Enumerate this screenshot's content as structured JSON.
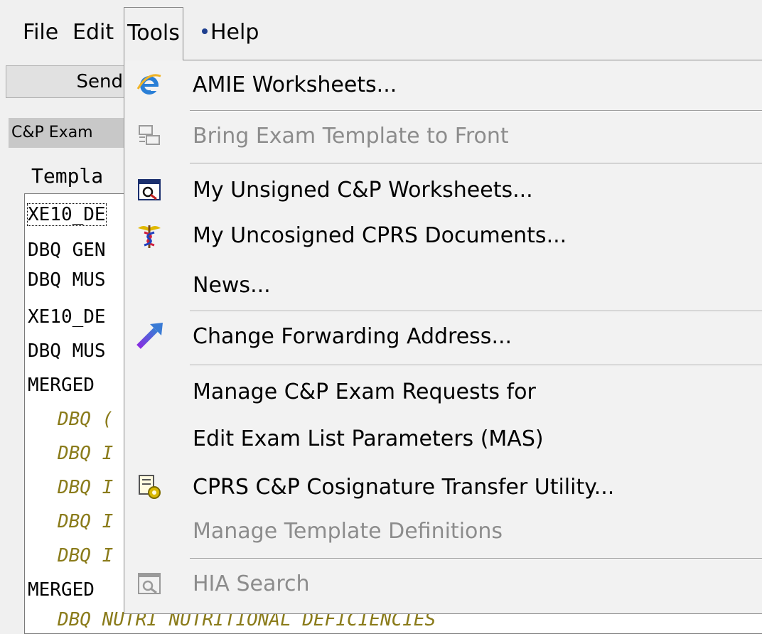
{
  "menubar": {
    "items": [
      {
        "label": "File",
        "accel": "F"
      },
      {
        "label": "Edit",
        "accel": "E"
      },
      {
        "label": "Tools",
        "accel": "T"
      },
      {
        "label": "Help",
        "accel": "H"
      }
    ]
  },
  "background": {
    "toolbar_button": "Send",
    "tab_label": "C&P Exam",
    "template_label": "Templa",
    "list_rows": [
      "XE10_DE",
      "DBQ GEN",
      "DBQ MUS",
      "XE10_DE",
      "DBQ MUS",
      "MERGED",
      "DBQ (",
      "DBQ I",
      "DBQ I",
      "DBQ I",
      "DBQ I",
      "MERGED"
    ],
    "partial_bottom_row": "DBQ NUTRI NUTRITIONAL DEFICIENCIES"
  },
  "tools_menu": {
    "items": [
      {
        "label": "AMIE Worksheets...",
        "icon": "ie-globe-icon",
        "enabled": true
      },
      {
        "label": "Bring Exam Template to Front",
        "icon": "template-front-icon",
        "enabled": false
      },
      {
        "label": "My Unsigned C&P Worksheets...",
        "icon": "window-search-icon",
        "enabled": true
      },
      {
        "label": "My Uncosigned CPRS Documents...",
        "icon": "caduceus-icon",
        "enabled": true
      },
      {
        "label": "News...",
        "icon": "",
        "enabled": true
      },
      {
        "label": "Change Forwarding Address...",
        "icon": "forward-arrow-icon",
        "enabled": true
      },
      {
        "label": "Manage C&P Exam Requests for",
        "icon": "",
        "enabled": true
      },
      {
        "label": "Edit Exam List Parameters (MAS)",
        "icon": "",
        "enabled": true
      },
      {
        "label": "CPRS C&P Cosignature Transfer Utility...",
        "icon": "document-gear-icon",
        "enabled": true
      },
      {
        "label": "Manage Template Definitions",
        "icon": "",
        "enabled": false
      },
      {
        "label": "HIA Search",
        "icon": "search-window-icon",
        "enabled": false
      }
    ]
  },
  "colors": {
    "menu_bg": "#f2f2f2",
    "disabled_text": "#8c8c8c",
    "italic_row_text": "#8a7b1a"
  }
}
